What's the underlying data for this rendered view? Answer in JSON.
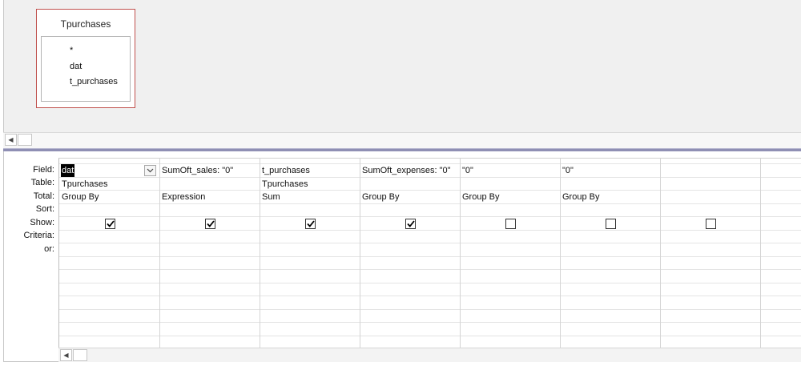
{
  "table_box": {
    "title": "Tpurchases",
    "fields": [
      "*",
      "dat",
      "t_purchases"
    ]
  },
  "row_labels": [
    "Field:",
    "Table:",
    "Total:",
    "Sort:",
    "Show:",
    "Criteria:",
    "or:"
  ],
  "columns": [
    {
      "field": "dat",
      "table": "Tpurchases",
      "total": "Group By",
      "sort": "",
      "show": true,
      "criteria": "",
      "or": ""
    },
    {
      "field": "SumOft_sales: \"0\"",
      "table": "",
      "total": "Expression",
      "sort": "",
      "show": true,
      "criteria": "",
      "or": ""
    },
    {
      "field": "t_purchases",
      "table": "Tpurchases",
      "total": "Sum",
      "sort": "",
      "show": true,
      "criteria": "",
      "or": ""
    },
    {
      "field": "SumOft_expenses: \"0\"",
      "table": "",
      "total": "Group By",
      "sort": "",
      "show": true,
      "criteria": "",
      "or": ""
    },
    {
      "field": "\"0\"",
      "table": "",
      "total": "Group By",
      "sort": "",
      "show": false,
      "criteria": "",
      "or": ""
    },
    {
      "field": "\"0\"",
      "table": "",
      "total": "Group By",
      "sort": "",
      "show": false,
      "criteria": "",
      "or": ""
    },
    {
      "field": "",
      "table": "",
      "total": "",
      "sort": "",
      "show": false,
      "criteria": "",
      "or": ""
    },
    {
      "field": "",
      "table": "",
      "total": "",
      "sort": "",
      "show": null,
      "criteria": "",
      "or": ""
    }
  ],
  "icons": {
    "dropdown": "chevron-down-icon",
    "checkmark": "checkmark-icon",
    "scroll_left": "arrow-left-icon"
  },
  "colors": {
    "table_border": "#c0504d",
    "splitter": "#8f8fb4",
    "selection": "#000000"
  }
}
